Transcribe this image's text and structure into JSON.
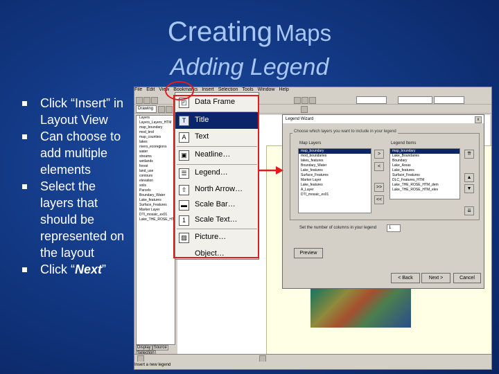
{
  "slide": {
    "title_line1_big": "Creating",
    "title_line1_small": "Maps",
    "title_line2": "Adding Legend",
    "bullets": [
      {
        "text": "Click “Insert” in Layout View"
      },
      {
        "text": "Can choose to add multiple elements"
      },
      {
        "text": "Select the layers that should be represented on the layout"
      },
      {
        "text_prefix": "Click “",
        "text_bold": "Next",
        "text_suffix": "”"
      }
    ]
  },
  "app": {
    "menubar": [
      "File",
      "Edit",
      "View",
      "Bookmarks",
      "Insert",
      "Selection",
      "Tools",
      "Window",
      "Help"
    ],
    "toolbar_combo_1": "Drawing",
    "toolbar_combo_2": "",
    "tabs": [
      "Display",
      "Source",
      "Selection"
    ],
    "status_text": "Insert a new legend"
  },
  "insert_menu": {
    "items": [
      {
        "label": "Data Frame",
        "icon": "data-frame-icon",
        "glyph": "◰"
      },
      {
        "label": "Title",
        "icon": "title-icon",
        "glyph": "T",
        "selected": true
      },
      {
        "label": "Text",
        "icon": "text-icon",
        "glyph": "A"
      },
      {
        "label": "Neatline…",
        "icon": "neatline-icon",
        "glyph": "▣"
      },
      {
        "label": "Legend…",
        "icon": "legend-icon",
        "glyph": "☰"
      },
      {
        "label": "North Arrow…",
        "icon": "north-arrow-icon",
        "glyph": "⇧"
      },
      {
        "label": "Scale Bar…",
        "icon": "scale-bar-icon",
        "glyph": "▬"
      },
      {
        "label": "Scale Text…",
        "icon": "scale-text-icon",
        "glyph": "1"
      },
      {
        "label": "Picture…",
        "icon": "picture-icon",
        "glyph": "▨"
      },
      {
        "label": "Object…",
        "icon": "object-icon",
        "glyph": ""
      }
    ]
  },
  "legend_wizard": {
    "title": "Legend Wizard",
    "group_label": "Choose which layers you want to include in your legend",
    "map_layers_header": "Map Layers",
    "legend_items_header": "Legend Items",
    "map_layers": [
      "map_boundary",
      "mod_boundaries",
      "lakes_features",
      "Boundary_Water",
      "Lake_features",
      "Surface_Features",
      "Marker Layer",
      "Lake_features",
      "A_Layer",
      "DTI_mosaic_ex01"
    ],
    "legend_items": [
      "map_boundary",
      "Lake_Boundaries",
      "Boundary",
      "Lake_Areas",
      "Lake_features",
      "Surface_Features",
      "DLC_Features_HTM",
      "Lake_THE_ROSE_HTM_dem",
      "Lake_THE_ROSE_HTM_elev"
    ],
    "columns_label": "Set the number of columns in your legend",
    "columns_value": "1",
    "preview_button": "Preview",
    "back_button": "< Back",
    "next_button": "Next >",
    "cancel_button": "Cancel",
    "move_right": ">",
    "move_all_right": ">>",
    "move_left": "<",
    "move_all_left": "<<",
    "close": "x"
  },
  "toc": {
    "items": [
      "Layers",
      "Layers_Layers_HTM",
      "map_boundary",
      "mod_bnd",
      "map_counties",
      "lakes",
      "rivers_ecoregions",
      "water",
      "streams",
      "wetlands",
      "forest",
      "land_use",
      "contours",
      "elevation",
      "soils",
      "Parcels",
      "Boundary_Water",
      "Lake_features",
      "Surface_Features",
      "Marker Layer",
      "DTI_mosaic_ex01",
      "Lake_THE_ROSE_HTM"
    ]
  },
  "colors": {
    "annotation_red": "#e41b1b",
    "menu_highlight": "#0b246a",
    "slide_title": "#a9c7f5"
  }
}
